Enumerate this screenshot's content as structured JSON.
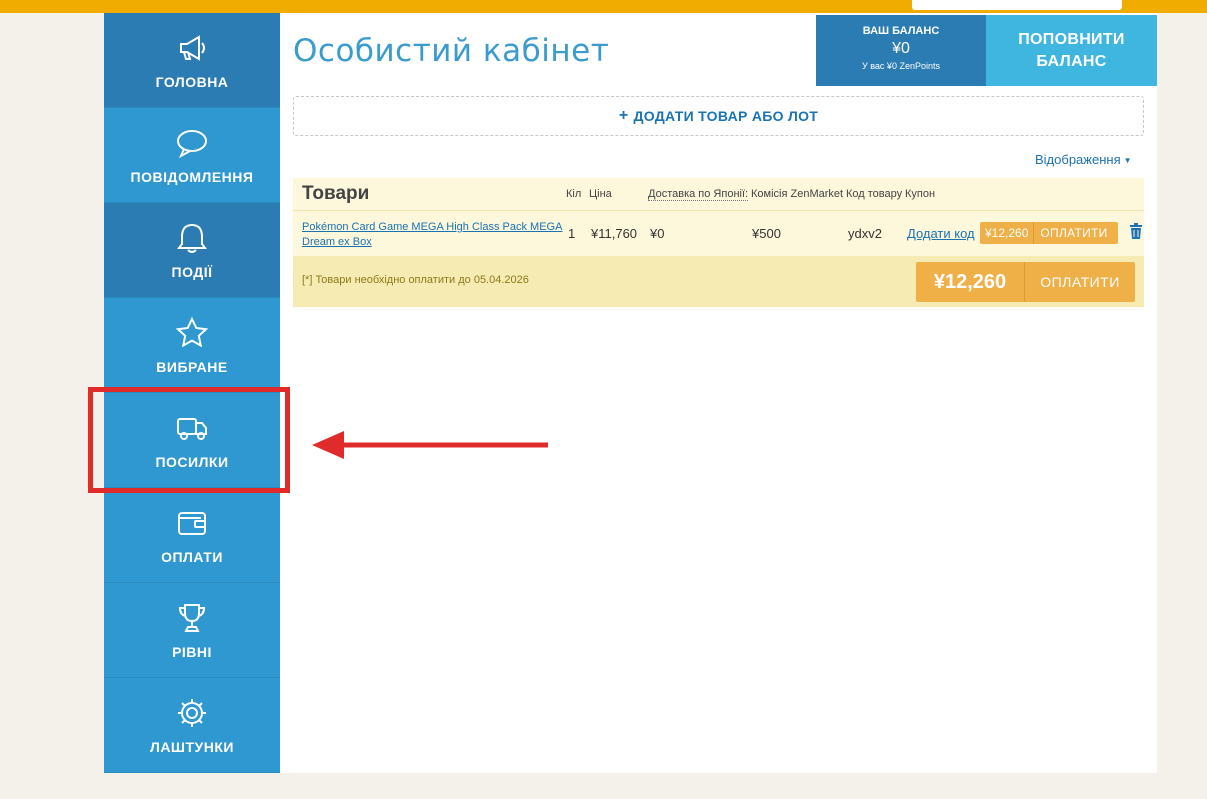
{
  "sidebar": {
    "items": [
      {
        "label": "ГОЛОВНА",
        "icon": "megaphone-icon"
      },
      {
        "label": "ПОВІДОМЛЕННЯ",
        "icon": "chat-bubble-icon"
      },
      {
        "label": "ПОДІЇ",
        "icon": "bell-icon"
      },
      {
        "label": "ВИБРАНЕ",
        "icon": "star-icon"
      },
      {
        "label": "ПОСИЛКИ",
        "icon": "truck-icon"
      },
      {
        "label": "ОПЛАТИ",
        "icon": "wallet-icon"
      },
      {
        "label": "РІВНІ",
        "icon": "trophy-icon"
      },
      {
        "label": "ЛАШТУНКИ",
        "icon": "gear-icon"
      }
    ]
  },
  "header": {
    "title": "Особистий кабінет"
  },
  "balance": {
    "title": "ВАШ БАЛАНС",
    "value": "¥0",
    "points": "У вас ¥0 ZenPoints"
  },
  "topup": {
    "line1": "ПОПОВНИТИ",
    "line2": "БАЛАНС"
  },
  "add_item": {
    "plus": "+",
    "label": "ДОДАТИ ТОВАР АБО ЛОТ"
  },
  "display_toggle": "Відображення",
  "goods": {
    "title": "Товари",
    "columns": {
      "qty": "Кіл",
      "price": "Ціна",
      "shipping": "Доставка по Японії:",
      "commission": "Комісія ZenMarket",
      "code": "Код товару",
      "coupon": "Купон"
    },
    "rows": [
      {
        "name": "Pokémon Card Game MEGA High Class Pack MEGA Dream ex Box",
        "qty": "1",
        "price": "¥11,760",
        "shipping": "¥0",
        "commission": "¥500",
        "code": "ydxv2",
        "add_code": "Додати код",
        "total": "¥12,260",
        "pay_label": "ОПЛАТИТИ"
      }
    ],
    "footer": {
      "note": "[*] Товари необхідно оплатити до 05.04.2026",
      "total": "¥12,260",
      "pay_label": "ОПЛАТИТИ"
    }
  },
  "colors": {
    "topbar": "#f0ad00",
    "sidebar_dark": "#2b7cb3",
    "sidebar_light": "#3098d0",
    "accent": "#3eb6e0",
    "pay": "#f0b048",
    "highlight": "#e02b2b"
  }
}
